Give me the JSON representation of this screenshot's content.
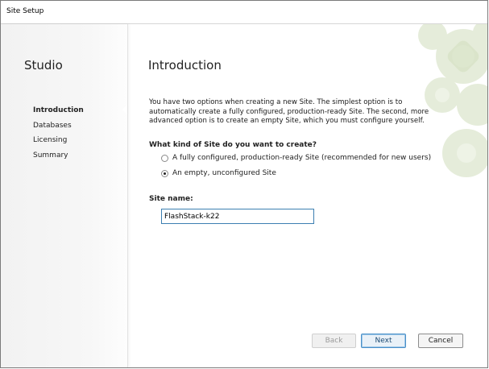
{
  "window": {
    "title": "Site Setup"
  },
  "sidebar": {
    "title": "Studio",
    "steps": [
      {
        "label": "Introduction",
        "active": true
      },
      {
        "label": "Databases",
        "active": false
      },
      {
        "label": "Licensing",
        "active": false
      },
      {
        "label": "Summary",
        "active": false
      }
    ]
  },
  "main": {
    "title": "Introduction",
    "intro_text": "You have two options when creating a new Site. The simplest option is to automatically create a fully configured, production-ready Site. The second, more advanced option is to create an empty Site, which you must configure yourself.",
    "question": "What kind of Site do you want to create?",
    "options": [
      {
        "label": "A fully configured, production-ready Site (recommended for new users)",
        "selected": false
      },
      {
        "label": "An empty, unconfigured Site",
        "selected": true
      }
    ],
    "site_name_label": "Site name:",
    "site_name_value": "FlashStack-k22"
  },
  "buttons": {
    "back": "Back",
    "next": "Next",
    "cancel": "Cancel",
    "back_enabled": false
  },
  "colors": {
    "accent": "#4a90c8",
    "decor_green": "#dfe8cf"
  }
}
